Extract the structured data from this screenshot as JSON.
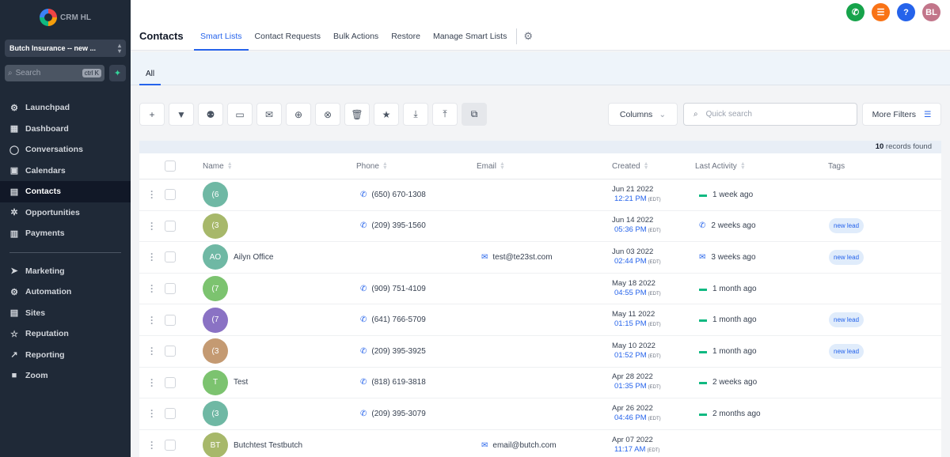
{
  "app": {
    "logo_text": "CRM HL"
  },
  "sidebar": {
    "account_name": "Butch Insurance -- new ...",
    "search_placeholder": "Search",
    "search_shortcut": "ctrl K",
    "items": [
      {
        "label": "Launchpad",
        "icon": "rocket-icon",
        "glyph": "⚙"
      },
      {
        "label": "Dashboard",
        "icon": "dashboard-icon",
        "glyph": "▦"
      },
      {
        "label": "Conversations",
        "icon": "chat-icon",
        "glyph": "◯"
      },
      {
        "label": "Calendars",
        "icon": "calendar-icon",
        "glyph": "▣"
      },
      {
        "label": "Contacts",
        "icon": "contacts-icon",
        "glyph": "▤",
        "active": true
      },
      {
        "label": "Opportunities",
        "icon": "opportunities-icon",
        "glyph": "✲"
      },
      {
        "label": "Payments",
        "icon": "payments-icon",
        "glyph": "▥"
      }
    ],
    "items2": [
      {
        "label": "Marketing",
        "icon": "send-icon",
        "glyph": "➤"
      },
      {
        "label": "Automation",
        "icon": "automation-icon",
        "glyph": "⚙"
      },
      {
        "label": "Sites",
        "icon": "sites-icon",
        "glyph": "▤"
      },
      {
        "label": "Reputation",
        "icon": "star-icon",
        "glyph": "☆"
      },
      {
        "label": "Reporting",
        "icon": "chart-line-icon",
        "glyph": "↗"
      },
      {
        "label": "Zoom",
        "icon": "video-icon",
        "glyph": "■"
      }
    ]
  },
  "header": {
    "title": "Contacts",
    "tabs": [
      "Smart Lists",
      "Contact Requests",
      "Bulk Actions",
      "Restore",
      "Manage Smart Lists"
    ],
    "avatar_initials": "BL",
    "icon_colors": {
      "phone": "#16a34a",
      "list": "#f97316",
      "help": "#2563eb",
      "avatar": "#c2758a"
    }
  },
  "subtab": "All",
  "toolbar": {
    "columns_label": "Columns",
    "quick_search_placeholder": "Quick search",
    "more_filters_label": "More Filters"
  },
  "records": {
    "count": "10",
    "suffix": " records found"
  },
  "table": {
    "columns": [
      "Name",
      "Phone",
      "Email",
      "Created",
      "Last Activity",
      "Tags"
    ],
    "rows": [
      {
        "initials": "(6",
        "avatar_color": "#6fb8a4",
        "name": "",
        "phone": "(650) 670-1308",
        "email": "",
        "date": "Jun 21 2022",
        "time": "12:21 PM",
        "tz": "(EDT)",
        "activity": "1 week ago",
        "activity_type": "chat",
        "tag": ""
      },
      {
        "initials": "(3",
        "avatar_color": "#a7b86a",
        "name": "",
        "phone": "(209) 395-1560",
        "email": "",
        "date": "Jun 14 2022",
        "time": "05:36 PM",
        "tz": "(EDT)",
        "activity": "2 weeks ago",
        "activity_type": "phone",
        "tag": "new lead"
      },
      {
        "initials": "AO",
        "avatar_color": "#6fb8a4",
        "name": "Ailyn Office",
        "phone": "",
        "email": "test@te23st.com",
        "date": "Jun 03 2022",
        "time": "02:44 PM",
        "tz": "(EDT)",
        "activity": "3 weeks ago",
        "activity_type": "email",
        "tag": "new lead"
      },
      {
        "initials": "(7",
        "avatar_color": "#7cc36f",
        "name": "",
        "phone": "(909) 751-4109",
        "email": "",
        "date": "May 18 2022",
        "time": "04:55 PM",
        "tz": "(EDT)",
        "activity": "1 month ago",
        "activity_type": "chat",
        "tag": ""
      },
      {
        "initials": "(7",
        "avatar_color": "#8a72c4",
        "name": "",
        "phone": "(641) 766-5709",
        "email": "",
        "date": "May 11 2022",
        "time": "01:15 PM",
        "tz": "(EDT)",
        "activity": "1 month ago",
        "activity_type": "chat",
        "tag": "new lead"
      },
      {
        "initials": "(3",
        "avatar_color": "#c49a72",
        "name": "",
        "phone": "(209) 395-3925",
        "email": "",
        "date": "May 10 2022",
        "time": "01:52 PM",
        "tz": "(EDT)",
        "activity": "1 month ago",
        "activity_type": "chat",
        "tag": "new lead"
      },
      {
        "initials": "T",
        "avatar_color": "#7cc36f",
        "name": "Test",
        "phone": "(818) 619-3818",
        "email": "",
        "date": "Apr 28 2022",
        "time": "01:35 PM",
        "tz": "(EDT)",
        "activity": "2 weeks ago",
        "activity_type": "chat",
        "tag": ""
      },
      {
        "initials": "(3",
        "avatar_color": "#6fb8a4",
        "name": "",
        "phone": "(209) 395-3079",
        "email": "",
        "date": "Apr 26 2022",
        "time": "04:46 PM",
        "tz": "(EDT)",
        "activity": "2 months ago",
        "activity_type": "chat",
        "tag": ""
      },
      {
        "initials": "BT",
        "avatar_color": "#a7b86a",
        "name": "Butchtest Testbutch",
        "phone": "",
        "email": "email@butch.com",
        "date": "Apr 07 2022",
        "time": "11:17 AM",
        "tz": "(EDT)",
        "activity": "",
        "activity_type": "",
        "tag": ""
      }
    ]
  }
}
